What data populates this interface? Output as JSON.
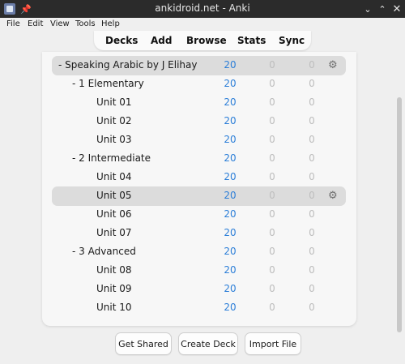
{
  "window": {
    "title": "ankidroid.net - Anki"
  },
  "menu": {
    "file": "File",
    "edit": "Edit",
    "view": "View",
    "tools": "Tools",
    "help": "Help"
  },
  "toolbar": {
    "decks": "Decks",
    "add": "Add",
    "browse": "Browse",
    "stats": "Stats",
    "sync": "Sync"
  },
  "decks": [
    {
      "name": "-  Speaking Arabic by J Elihay",
      "due": "20",
      "new": "0",
      "review": "0",
      "gear": "⚙"
    },
    {
      "name": "-  1 Elementary",
      "due": "20",
      "new": "0",
      "review": "0"
    },
    {
      "name": "Unit 01",
      "due": "20",
      "new": "0",
      "review": "0"
    },
    {
      "name": "Unit 02",
      "due": "20",
      "new": "0",
      "review": "0"
    },
    {
      "name": "Unit 03",
      "due": "20",
      "new": "0",
      "review": "0"
    },
    {
      "name": "-  2 Intermediate",
      "due": "20",
      "new": "0",
      "review": "0"
    },
    {
      "name": "Unit 04",
      "due": "20",
      "new": "0",
      "review": "0"
    },
    {
      "name": "Unit 05",
      "due": "20",
      "new": "0",
      "review": "0",
      "gear": "⚙"
    },
    {
      "name": "Unit 06",
      "due": "20",
      "new": "0",
      "review": "0"
    },
    {
      "name": "Unit 07",
      "due": "20",
      "new": "0",
      "review": "0"
    },
    {
      "name": "-  3 Advanced",
      "due": "20",
      "new": "0",
      "review": "0"
    },
    {
      "name": "Unit 08",
      "due": "20",
      "new": "0",
      "review": "0"
    },
    {
      "name": "Unit 09",
      "due": "20",
      "new": "0",
      "review": "0"
    },
    {
      "name": "Unit 10",
      "due": "20",
      "new": "0",
      "review": "0"
    }
  ],
  "buttons": {
    "get_shared": "Get Shared",
    "create_deck": "Create Deck",
    "import_file": "Import File"
  },
  "colors": {
    "due": "#2d7fd8",
    "muted": "#bdbdbd",
    "titlebar": "#2b2b2b",
    "highlight": "#dcdcdc"
  }
}
